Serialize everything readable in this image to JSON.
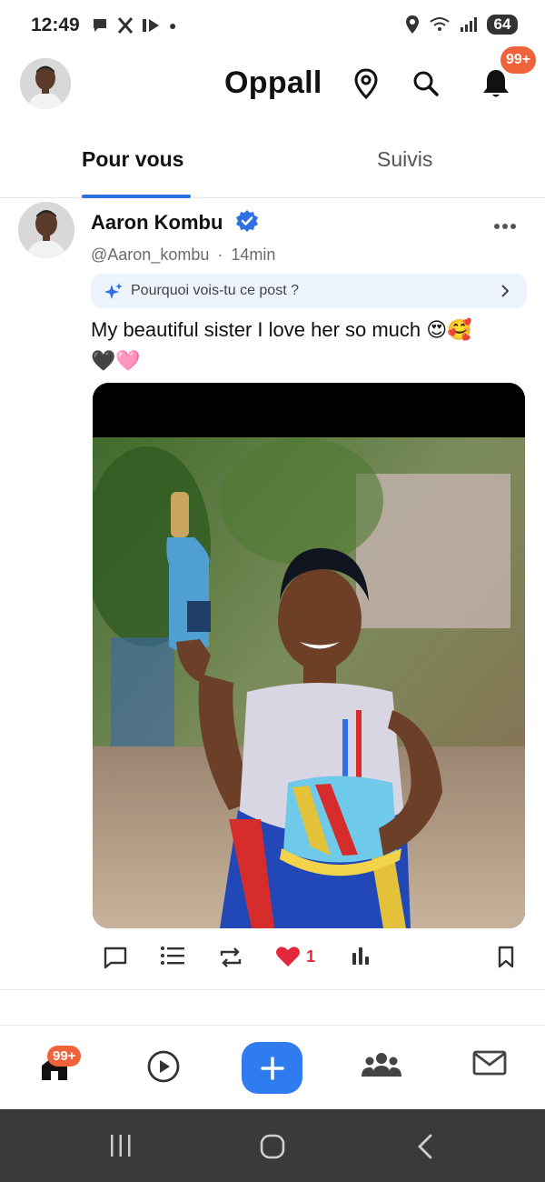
{
  "status_bar": {
    "time": "12:49",
    "battery": "64",
    "notification_icons": [
      "message-icon",
      "x-logo-icon",
      "media-icon",
      "dot"
    ]
  },
  "header": {
    "title": "Oppall",
    "notification_badge": "99+"
  },
  "tabs": [
    {
      "label": "Pour vous",
      "active": true
    },
    {
      "label": "Suivis",
      "active": false
    }
  ],
  "post": {
    "author_name": "Aaron Kombu",
    "verified": true,
    "handle": "@Aaron_kombu",
    "separator": "·",
    "time_ago": "14min",
    "why_prompt": "Pourquoi vois-tu ce post ?",
    "text_line1": "My beautiful sister I love her so much 😍🥰",
    "text_line2": "🖤🩷",
    "actions": {
      "likes": "1"
    }
  },
  "bottom_nav": {
    "home_badge": "99+"
  },
  "colors": {
    "accent": "#2f6fe4",
    "badge": "#f0623a",
    "like": "#e5273e",
    "fab": "#2f7bf0"
  }
}
